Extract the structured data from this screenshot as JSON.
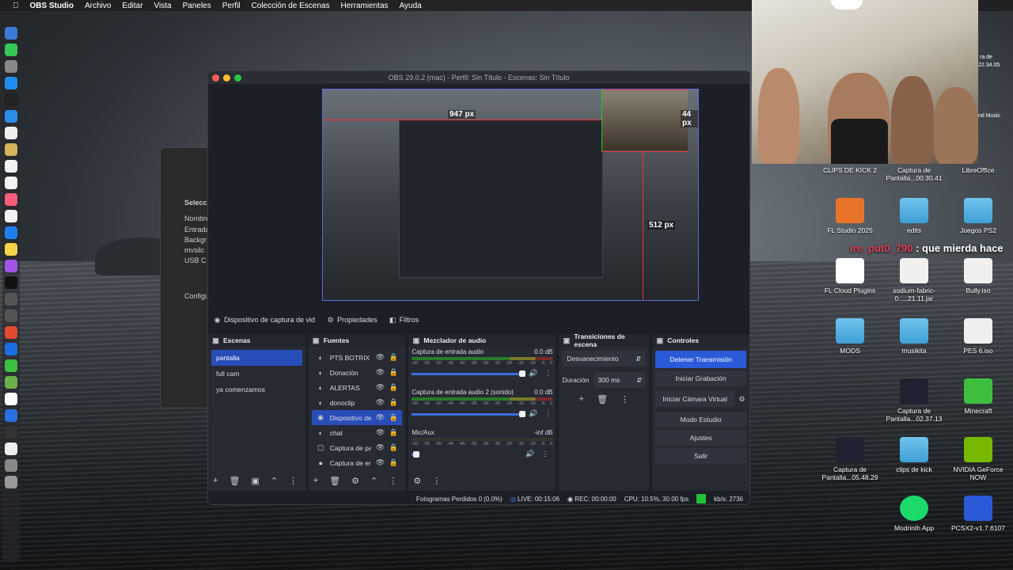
{
  "menubar": {
    "app": "OBS Studio",
    "items": [
      "Archivo",
      "Editar",
      "Vista",
      "Paneles",
      "Perfil",
      "Colección de Escenas",
      "Herramientas",
      "Ayuda"
    ]
  },
  "bg_window": {
    "labels": [
      "Selecci",
      "Nombre",
      "Entrada",
      "Backgr",
      "mvsilc",
      "USB C",
      "Configu"
    ]
  },
  "obs": {
    "title": "OBS 29.0.2 (mac) - Perfil: Sin Título - Escenas: Sin Título",
    "preview": {
      "label_width": "947 px",
      "label_offset": "44 px",
      "label_height": "512 px"
    },
    "source_bar": {
      "selected_source": "Dispositivo de captura de vid",
      "properties": "Propiedades",
      "filters": "Filtros"
    },
    "scenes": {
      "header": "Escenas",
      "items": [
        "pantalla",
        "full cam",
        "ya comenzamos"
      ],
      "selected_index": 0
    },
    "sources": {
      "header": "Fuentes",
      "items": [
        {
          "name": "PTS BOTRIX",
          "icon": "browser-icon"
        },
        {
          "name": "Donación",
          "icon": "browser-icon"
        },
        {
          "name": "ALERTAS",
          "icon": "browser-icon"
        },
        {
          "name": "donoclip",
          "icon": "browser-icon"
        },
        {
          "name": "Dispositivo de",
          "icon": "camera-icon"
        },
        {
          "name": "chat",
          "icon": "browser-icon"
        },
        {
          "name": "Captura de pa",
          "icon": "monitor-icon"
        },
        {
          "name": "Captura de en",
          "icon": "mic-icon"
        }
      ],
      "selected_index": 4
    },
    "mixer": {
      "header": "Mezclador de audio",
      "scale": [
        "-60",
        "-55",
        "-50",
        "-45",
        "-40",
        "-35",
        "-30",
        "-25",
        "-20",
        "-15",
        "-10",
        "-5",
        "0"
      ],
      "channels": [
        {
          "name": "Captura de entrada audio",
          "level": "0.0 dB"
        },
        {
          "name": "Captura de entrada audio 2 (sonido)",
          "level": "0.0 dB"
        },
        {
          "name": "Mic/Aux",
          "level": "-inf dB"
        }
      ]
    },
    "transitions": {
      "header": "Transiciones de escena",
      "type": "Desvanecimiento",
      "duration_label": "Duración",
      "duration_value": "300 ms"
    },
    "controls": {
      "header": "Controles",
      "buttons": [
        "Detener Transmisión",
        "Iniciar Grabación",
        "Iniciar Cámara Virtual",
        "Modo Estudio",
        "Ajustes",
        "Salir"
      ]
    },
    "status": {
      "dropped": "Fotogramas Perdidos 0 (0.0%)",
      "live": "LIVE: 00:15:06",
      "rec": "REC: 00:00:00",
      "cpu": "CPU: 10.5%, 30.00 fps",
      "kbs": "kb/s: 2736"
    }
  },
  "webcam": {
    "side_text_1": "ra de",
    "side_text_2": "22.34.05",
    "side_text_3": "nd Music"
  },
  "chat": {
    "user": "ire_put0_790",
    "message": " : que mierda hace"
  },
  "desktop_icons": [
    {
      "label": "CLIPS DE KICK 2",
      "kind": "dark"
    },
    {
      "label": "Captura de Pantalla...00.30.41",
      "kind": "file"
    },
    {
      "label": "LibreOffice",
      "kind": "file"
    },
    {
      "label": "FL Studio 2025",
      "kind": "dark"
    },
    {
      "label": "edits",
      "kind": "folder"
    },
    {
      "label": "Juegos PS2",
      "kind": "folder"
    },
    {
      "label": "FL Cloud Plugins",
      "kind": "dark"
    },
    {
      "label": "sodium-fabric-0.....21.11.jar",
      "kind": "file"
    },
    {
      "label": "Bully.iso",
      "kind": "file"
    },
    {
      "label": "MODS",
      "kind": "folder"
    },
    {
      "label": "musikita",
      "kind": "folder"
    },
    {
      "label": "PES 6.iso",
      "kind": "file"
    },
    {
      "label": "Captura de Pantalla...02.37.13",
      "kind": "dark"
    },
    {
      "label": "Minecraft",
      "kind": "green"
    },
    {
      "label": "Captura de Pantalla...05.48.29",
      "kind": "dark"
    },
    {
      "label": "clips de kick",
      "kind": "folder"
    },
    {
      "label": "NVIDIA GeForce NOW",
      "kind": "green"
    },
    {
      "label": "Modrinth App",
      "kind": "dark"
    },
    {
      "label": "PCSX2-v1.7.6107",
      "kind": "dark"
    }
  ],
  "colors": {
    "accent": "#284cb8",
    "stream_live": "#22c23a"
  }
}
